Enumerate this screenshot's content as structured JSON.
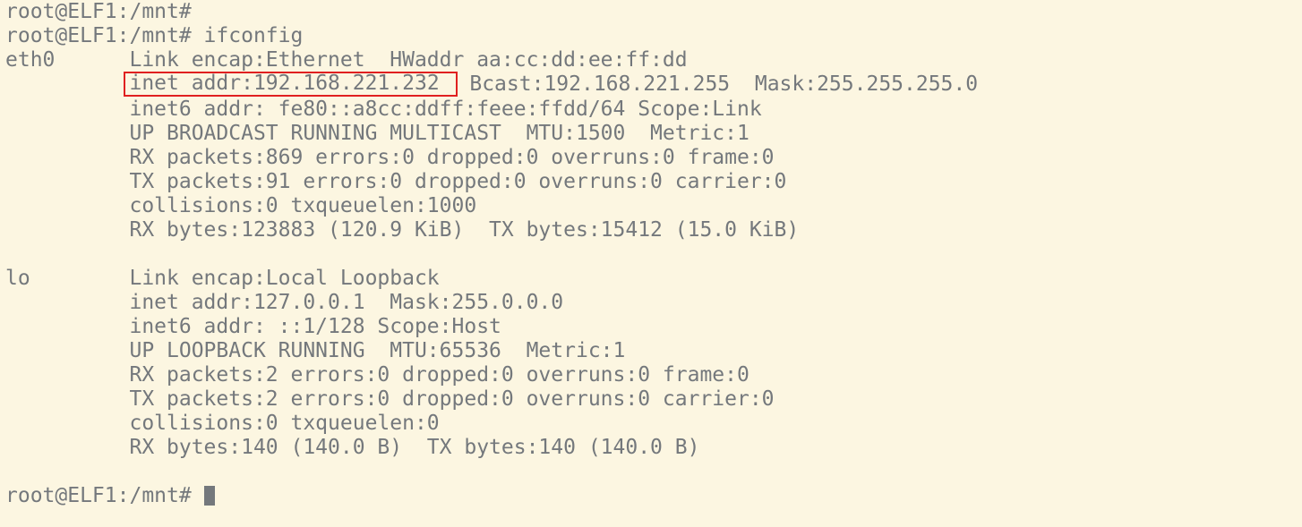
{
  "line01": "root@ELF1:/mnt#",
  "line02": "root@ELF1:/mnt# ifconfig",
  "line03a": "eth0      Link encap:Ethernet  HWaddr aa:cc:dd:ee:ff:dd",
  "line04hl": "inet addr:192.168.221.232 ",
  "line04b": " Bcast:192.168.221.255  Mask:255.255.255.0",
  "line05": "          inet6 addr: fe80::a8cc:ddff:feee:ffdd/64 Scope:Link",
  "line06": "          UP BROADCAST RUNNING MULTICAST  MTU:1500  Metric:1",
  "line07": "          RX packets:869 errors:0 dropped:0 overruns:0 frame:0",
  "line08": "          TX packets:91 errors:0 dropped:0 overruns:0 carrier:0",
  "line09": "          collisions:0 txqueuelen:1000",
  "line10": "          RX bytes:123883 (120.9 KiB)  TX bytes:15412 (15.0 KiB)",
  "line11": "",
  "line12": "lo        Link encap:Local Loopback",
  "line13": "          inet addr:127.0.0.1  Mask:255.0.0.0",
  "line14": "          inet6 addr: ::1/128 Scope:Host",
  "line15": "          UP LOOPBACK RUNNING  MTU:65536  Metric:1",
  "line16": "          RX packets:2 errors:0 dropped:0 overruns:0 frame:0",
  "line17": "          TX packets:2 errors:0 dropped:0 overruns:0 carrier:0",
  "line18": "          collisions:0 txqueuelen:0",
  "line19": "          RX bytes:140 (140.0 B)  TX bytes:140 (140.0 B)",
  "line20": "",
  "line21": "root@ELF1:/mnt# "
}
